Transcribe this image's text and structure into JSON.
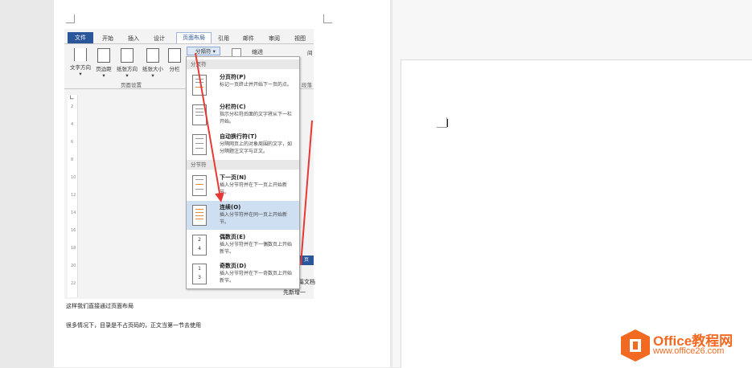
{
  "tabs": [
    "文件",
    "开始",
    "插入",
    "设计",
    "页面布局",
    "引用",
    "邮件",
    "审阅",
    "视图"
  ],
  "ribbon": {
    "buttons": [
      "文字方向",
      "页边距",
      "纸张方向",
      "纸张大小",
      "分栏"
    ],
    "group_label": "页面设置",
    "break_button": "分隔符",
    "indent_label": "缩进",
    "spacing_label": "间",
    "para_label": "段落"
  },
  "menu": {
    "section1": "分页符",
    "section2": "分节符",
    "items": [
      {
        "title": "分页符(P)",
        "desc": "标记一页终止并开始下一页的点。"
      },
      {
        "title": "分栏符(C)",
        "desc": "指示分栏符后面的文字将从下一栏开始。"
      },
      {
        "title": "自动换行符(T)",
        "desc": "分隔网页上的对象周围的文字，如分隔题注文字与正文。"
      },
      {
        "title": "下一页(N)",
        "desc": "插入分节符并在下一页上开始新节。"
      },
      {
        "title": "连续(O)",
        "desc": "插入分节符并在同一页上开始新节。"
      },
      {
        "title": "偶数页(E)",
        "desc": "插入分节符并在下一偶数页上开始新节。"
      },
      {
        "title": "奇数页(D)",
        "desc": "插入分节符并在下一奇数页上开始新节。"
      }
    ]
  },
  "doc": {
    "line1": "这样我们直接通过页面布局",
    "line2": "很多情况下，目录是不占页码的，正文当第一节去使用",
    "side1": "篇文档",
    "side2": "先新增一"
  },
  "ruler_ticks": [
    "2",
    "4",
    "6",
    "8",
    "10",
    "12",
    "14",
    "16",
    "18",
    "20",
    "22"
  ],
  "icon_numbers": {
    "even": [
      "2",
      "4"
    ],
    "odd": [
      "1",
      "3"
    ]
  },
  "logo": {
    "brand": "Office教程网",
    "url": "www.office26.com"
  },
  "colors": {
    "accent": "#2b579a",
    "arrow": "#e53935",
    "highlight": "#cfdff2",
    "logo_orange": "#f26a21"
  }
}
